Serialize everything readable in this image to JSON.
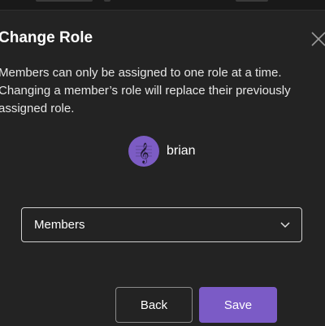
{
  "dialog": {
    "title": "Change Role",
    "description": "Members can only be assigned to one role at a time. Changing a member’s role will replace their previously assigned role.",
    "close_icon": "close-icon"
  },
  "member": {
    "name": "brian",
    "avatar_icon": "treble-clef-icon",
    "avatar_color": "#7c5cc4"
  },
  "role_select": {
    "selected": "Members",
    "icon": "chevron-down-icon"
  },
  "actions": {
    "back_label": "Back",
    "save_label": "Save",
    "save_color": "#7b5bc6"
  }
}
